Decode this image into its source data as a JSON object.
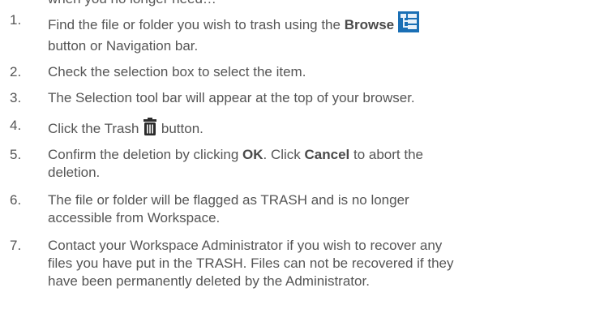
{
  "intro_partial": "when you no longer need…",
  "steps": [
    {
      "number": "1.",
      "pre": "Find the file or folder you wish to trash using the ",
      "bold": "Browse",
      "post_line2": "button or Navigation bar.",
      "icon": "browse-tree-icon"
    },
    {
      "number": "2.",
      "text": "Check the selection box to select the item."
    },
    {
      "number": "3.",
      "text": "The Selection tool bar will appear at the top of your browser."
    },
    {
      "number": "4.",
      "pre": "Click the Trash ",
      "post": " button.",
      "icon": "trash-icon"
    },
    {
      "number": "5.",
      "pre": "Confirm the deletion by clicking ",
      "bold1": "OK",
      "mid": ". Click ",
      "bold2": "Cancel",
      "post": " to abort the",
      "line2": "deletion."
    },
    {
      "number": "6.",
      "line1": "The file or folder will be flagged as TRASH and is no longer",
      "line2": "accessible from Workspace."
    },
    {
      "number": "7.",
      "line1": "Contact your Workspace Administrator if you wish to recover any",
      "line2": "files you have put in the TRASH. Files can not be recovered if they",
      "line3": "have been permanently deleted by the Administrator."
    }
  ],
  "colors": {
    "text": "#555555",
    "icon_blue": "#1a6fb5",
    "icon_dark": "#2b2b2b"
  }
}
